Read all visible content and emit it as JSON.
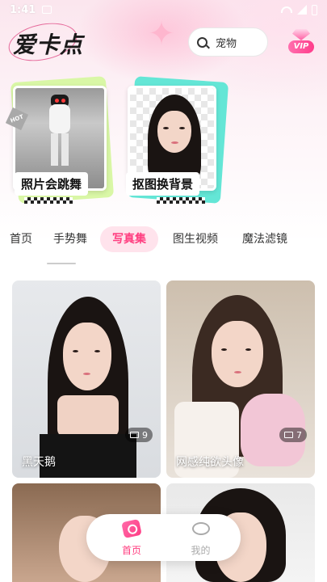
{
  "status_bar": {
    "time": "1:41"
  },
  "header": {
    "logo": "爱卡点",
    "search_placeholder": "宠物",
    "vip_label": "VIP"
  },
  "features": [
    {
      "label": "照片会跳舞",
      "tag": "HOT"
    },
    {
      "label": "抠图换背景"
    }
  ],
  "tabs": [
    {
      "label": "首页",
      "active": false
    },
    {
      "label": "手势舞",
      "active": false
    },
    {
      "label": "写真集",
      "active": true
    },
    {
      "label": "图生视频",
      "active": false
    },
    {
      "label": "魔法滤镜",
      "active": false
    }
  ],
  "cards": [
    {
      "title": "黑天鹅",
      "count": "9"
    },
    {
      "title": "网感纯欲头像",
      "count": "7"
    }
  ],
  "bottom_nav": [
    {
      "label": "首页",
      "active": true
    },
    {
      "label": "我的",
      "active": false
    }
  ],
  "colors": {
    "accent": "#ff3d7f",
    "tab_active_bg": "#ffe3ec"
  }
}
